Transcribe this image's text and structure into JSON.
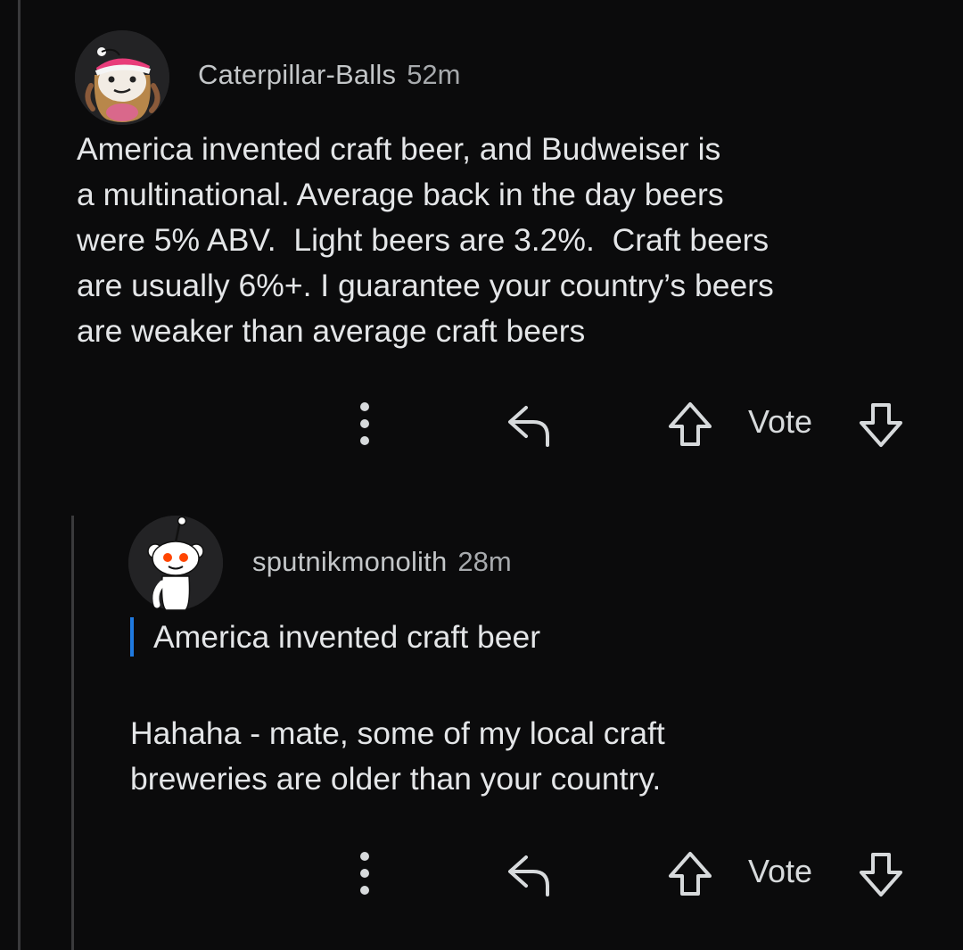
{
  "comments": [
    {
      "username": "Caterpillar-Balls",
      "time": "52m",
      "body": "America invented craft beer, and Budweiser is\na multinational. Average back in the day beers\nwere 5% ABV.  Light beers are 3.2%.  Craft beers\nare usually 6%+. I guarantee your country’s beers\nare weaker than average craft beers",
      "avatar_icon": "snoo-avatar-santa-hat",
      "actions": {
        "more_icon": "more-vertical-icon",
        "reply_icon": "reply-icon",
        "upvote_icon": "upvote-arrow-icon",
        "vote_label": "Vote",
        "downvote_icon": "downvote-arrow-icon"
      }
    },
    {
      "username": "sputnikmonolith",
      "time": "28m",
      "quote": "America invented craft beer",
      "body": "Hahaha - mate, some of my local craft\nbreweries are older than your country.",
      "avatar_icon": "snoo-avatar-default",
      "actions": {
        "more_icon": "more-vertical-icon",
        "reply_icon": "reply-icon",
        "upvote_icon": "upvote-arrow-icon",
        "vote_label": "Vote",
        "downvote_icon": "downvote-arrow-icon"
      }
    }
  ],
  "colors": {
    "background": "#0b0b0c",
    "text": "#e4e6e8",
    "meta": "#c3c6c8",
    "quote_bar": "#1f7ae0",
    "thread_line": "#3a3a3c"
  }
}
